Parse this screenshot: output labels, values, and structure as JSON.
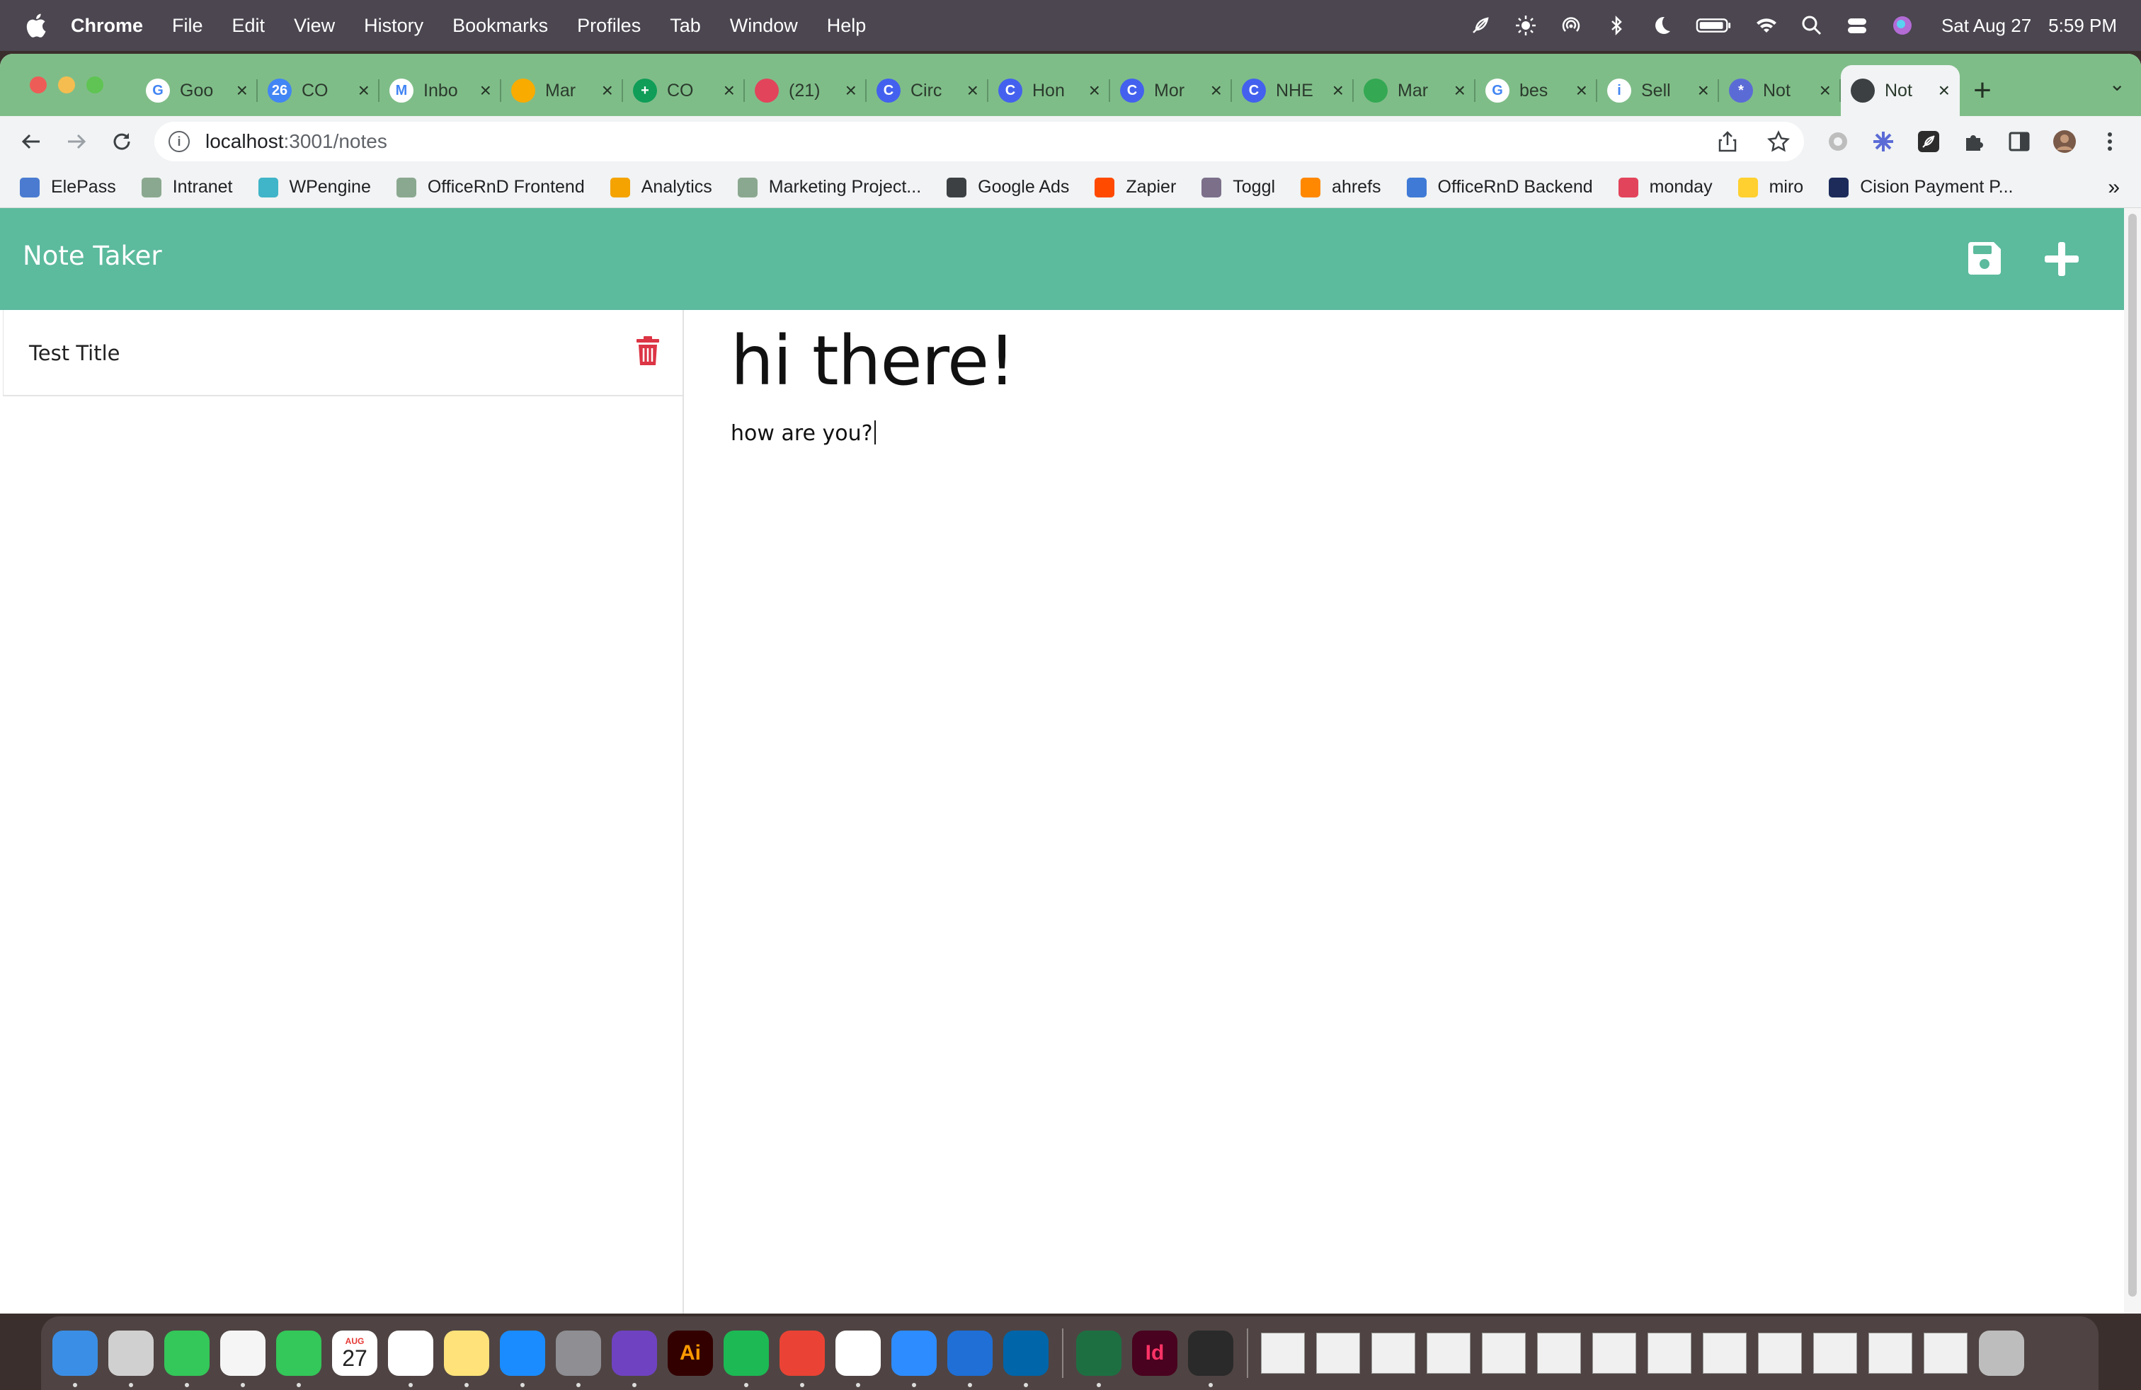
{
  "menubar": {
    "app": "Chrome",
    "items": [
      "File",
      "Edit",
      "View",
      "History",
      "Bookmarks",
      "Profiles",
      "Tab",
      "Window",
      "Help"
    ],
    "date": "Sat Aug 27",
    "time": "5:59 PM"
  },
  "tabs": [
    {
      "label": "Goo",
      "color": "#ffffff",
      "glyph": "G"
    },
    {
      "label": "CO",
      "color": "#4285f4",
      "glyph": "26"
    },
    {
      "label": "Inbo",
      "color": "#ffffff",
      "glyph": "M"
    },
    {
      "label": "Mar",
      "color": "#f9ab00",
      "glyph": ""
    },
    {
      "label": "CO",
      "color": "#0f9d58",
      "glyph": "+"
    },
    {
      "label": "(21)",
      "color": "#e2445c",
      "glyph": ""
    },
    {
      "label": "Circ",
      "color": "#4361ee",
      "glyph": "C"
    },
    {
      "label": "Hon",
      "color": "#4361ee",
      "glyph": "C"
    },
    {
      "label": "Mor",
      "color": "#4361ee",
      "glyph": "C"
    },
    {
      "label": "NHE",
      "color": "#4361ee",
      "glyph": "C"
    },
    {
      "label": "Mar",
      "color": "#34a853",
      "glyph": ""
    },
    {
      "label": "bes",
      "color": "#ffffff",
      "glyph": "G"
    },
    {
      "label": "Sell",
      "color": "#ffffff",
      "glyph": "i"
    },
    {
      "label": "Not",
      "color": "#5b6bd6",
      "glyph": "*"
    },
    {
      "label": "Not",
      "color": "#3c4043",
      "glyph": ""
    }
  ],
  "address": {
    "host": "localhost",
    "path": ":3001/notes"
  },
  "bookmarks": [
    {
      "label": "ElePass",
      "color": "#4a7bd0"
    },
    {
      "label": "Intranet",
      "color": "#8aa88f"
    },
    {
      "label": "WPengine",
      "color": "#40b4c8"
    },
    {
      "label": "OfficeRnD Frontend",
      "color": "#8aa88f"
    },
    {
      "label": "Analytics",
      "color": "#f4a300"
    },
    {
      "label": "Marketing Project...",
      "color": "#8aa88f"
    },
    {
      "label": "Google Ads",
      "color": "#3c4043"
    },
    {
      "label": "Zapier",
      "color": "#ff4a00"
    },
    {
      "label": "Toggl",
      "color": "#7b6f8a"
    },
    {
      "label": "ahrefs",
      "color": "#ff8800"
    },
    {
      "label": "OfficeRnD Backend",
      "color": "#3f7ad6"
    },
    {
      "label": "monday",
      "color": "#e2445c"
    },
    {
      "label": "miro",
      "color": "#ffd02f"
    },
    {
      "label": "Cision Payment P...",
      "color": "#1c2b5a"
    }
  ],
  "app": {
    "title": "Note Taker",
    "header_color": "#5cba9d",
    "notes": [
      {
        "title": "Test Title"
      }
    ],
    "active_note": {
      "title": "hi there!",
      "text": "how are you?"
    }
  },
  "dock": {
    "apps": [
      {
        "name": "finder",
        "color": "#3a8ee6"
      },
      {
        "name": "launchpad",
        "color": "#d0d0d0"
      },
      {
        "name": "messages",
        "color": "#34c759"
      },
      {
        "name": "photos",
        "color": "#f5f5f5"
      },
      {
        "name": "facetime",
        "color": "#34c759"
      },
      {
        "name": "calendar",
        "color": "#ffffff"
      },
      {
        "name": "reminders",
        "color": "#ffffff"
      },
      {
        "name": "notes",
        "color": "#ffe27a"
      },
      {
        "name": "app-store",
        "color": "#1a8cff"
      },
      {
        "name": "system-preferences",
        "color": "#8e8e93"
      },
      {
        "name": "github-desktop",
        "color": "#6f42c1"
      },
      {
        "name": "illustrator",
        "color": "#330000"
      },
      {
        "name": "spotify",
        "color": "#1db954"
      },
      {
        "name": "chrome",
        "color": "#ea4335"
      },
      {
        "name": "slack",
        "color": "#ffffff"
      },
      {
        "name": "zoom",
        "color": "#2d8cff"
      },
      {
        "name": "xcode",
        "color": "#1f6fd6"
      },
      {
        "name": "vscode",
        "color": "#0065a9"
      },
      {
        "name": "excel",
        "color": "#1d6f42"
      },
      {
        "name": "indesign",
        "color": "#49021f"
      },
      {
        "name": "app",
        "color": "#2a2a2a"
      }
    ],
    "calendar_month": "AUG",
    "calendar_day": "27",
    "illustrator_label": "Ai",
    "indesign_label": "Id"
  }
}
